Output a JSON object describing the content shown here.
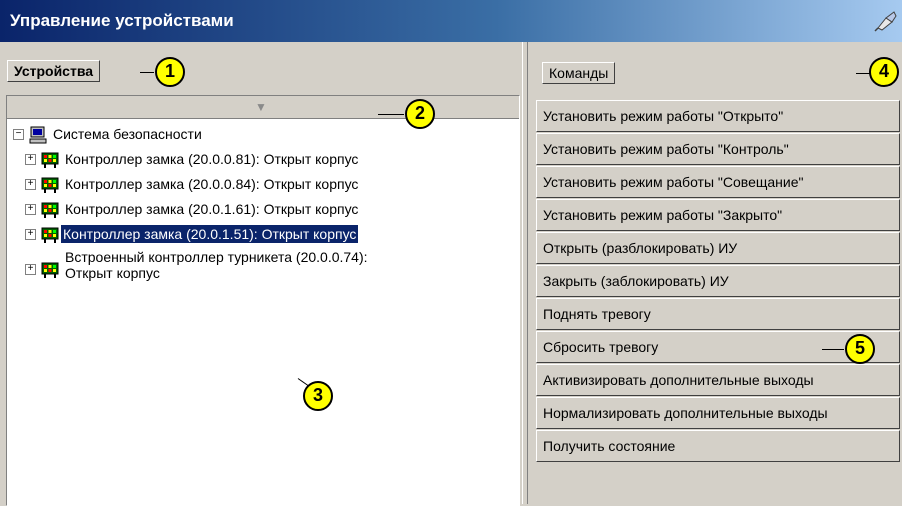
{
  "window": {
    "title": "Управление устройствами",
    "pin_icon": "pin-icon"
  },
  "left_panel": {
    "tab_label": "Устройства",
    "tree": {
      "root": {
        "label": "Система безопасности",
        "icon": "computer-icon"
      },
      "items": [
        {
          "label": "Контроллер замка (20.0.0.81): Открыт корпус",
          "icon": "controller-icon",
          "selected": false
        },
        {
          "label": "Контроллер замка (20.0.0.84): Открыт корпус",
          "icon": "controller-icon",
          "selected": false
        },
        {
          "label": "Контроллер замка (20.0.1.61): Открыт корпус",
          "icon": "controller-icon",
          "selected": false
        },
        {
          "label": "Контроллер замка (20.0.1.51): Открыт корпус",
          "icon": "controller-icon",
          "selected": true
        },
        {
          "label_line1": "Встроенный контроллер турникета (20.0.0.74):",
          "label_line2": "Открыт корпус",
          "icon": "controller-icon",
          "selected": false
        }
      ]
    }
  },
  "right_panel": {
    "tab_label": "Команды",
    "commands": [
      "Установить режим работы \"Открыто\"",
      "Установить режим работы \"Контроль\"",
      "Установить режим работы \"Совещание\"",
      "Установить режим работы \"Закрыто\"",
      "Открыть (разблокировать) ИУ",
      "Закрыть (заблокировать) ИУ",
      "Поднять тревогу",
      "Сбросить тревогу",
      "Активизировать дополнительные выходы",
      "Нормализировать дополнительные выходы",
      "Получить состояние"
    ]
  },
  "callouts": [
    "1",
    "2",
    "3",
    "4",
    "5"
  ],
  "colors": {
    "selection": "#0a246a",
    "callout": "#ffff00",
    "title_start": "#0a246a",
    "title_end": "#a6caf0"
  }
}
